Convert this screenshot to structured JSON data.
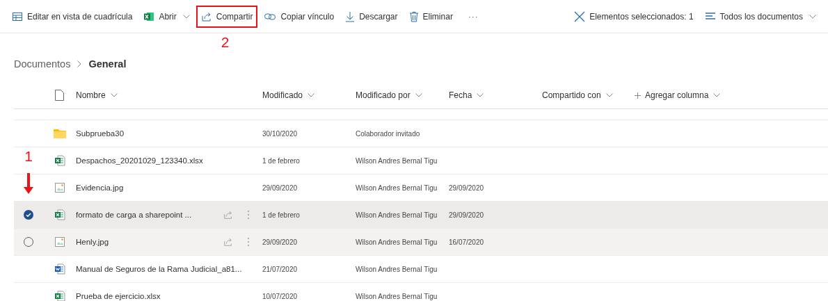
{
  "toolbar": {
    "left": [
      {
        "kind": "grid",
        "label": "Editar en vista de cuadrícula"
      },
      {
        "kind": "excel",
        "label": "Abrir",
        "dropdown": true
      },
      {
        "kind": "share",
        "label": "Compartir",
        "highlighted": true,
        "annotation": "2"
      },
      {
        "kind": "link",
        "label": "Copiar vínculo"
      },
      {
        "kind": "download",
        "label": "Descargar"
      },
      {
        "kind": "trash",
        "label": "Eliminar"
      },
      {
        "kind": "more",
        "label": "···"
      }
    ],
    "right": [
      {
        "kind": "close",
        "label": "Elementos seleccionados: 1"
      },
      {
        "kind": "view",
        "label": "Todos los documentos",
        "dropdown": true
      }
    ]
  },
  "breadcrumb": [
    "Documentos",
    "General"
  ],
  "table": {
    "columns": [
      "Nombre",
      "Modificado",
      "Modificado por",
      "Fecha",
      "Compartido con",
      "Agregar columna"
    ],
    "rows": [
      {
        "kind": "folder",
        "name": "Subprueba30",
        "modified": "30/10/2020",
        "modified_by": "Colaborador invitado",
        "selected": false,
        "hovered": false
      },
      {
        "kind": "excel",
        "name": "Despachos_20201029_123340.xlsx",
        "modified": "1 de febrero",
        "modified_by": "Wilson Andres Bernal Tigu",
        "selected": false,
        "hovered": false
      },
      {
        "kind": "image",
        "name": "Evidencia.jpg",
        "modified": "29/09/2020",
        "modified_by": "Wilson Andres Bernal Tigu",
        "date": "29/09/2020",
        "selected": false,
        "hovered": false
      },
      {
        "kind": "excel",
        "name": "formato de carga a sharepoint ...",
        "modified": "1 de febrero",
        "modified_by": "Wilson Andres Bernal Tigu",
        "date": "29/09/2020",
        "selected": true,
        "hovered": false,
        "annotation": "1"
      },
      {
        "kind": "image",
        "name": "Henly.jpg",
        "modified": "29/09/2020",
        "modified_by": "Wilson Andres Bernal Tigu",
        "date": "16/07/2020",
        "selected": false,
        "hovered": true
      },
      {
        "kind": "word",
        "name": "Manual de Seguros de la Rama Judicial_a81...",
        "modified": "21/07/2020",
        "modified_by": "Wilson Andres Bernal Tigu",
        "selected": false,
        "hovered": false
      },
      {
        "kind": "excel",
        "name": "Prueba de ejercicio.xlsx",
        "modified": "10/07/2020",
        "modified_by": "Wilson Andres Bernal Tigu",
        "selected": false,
        "hovered": false
      }
    ]
  }
}
